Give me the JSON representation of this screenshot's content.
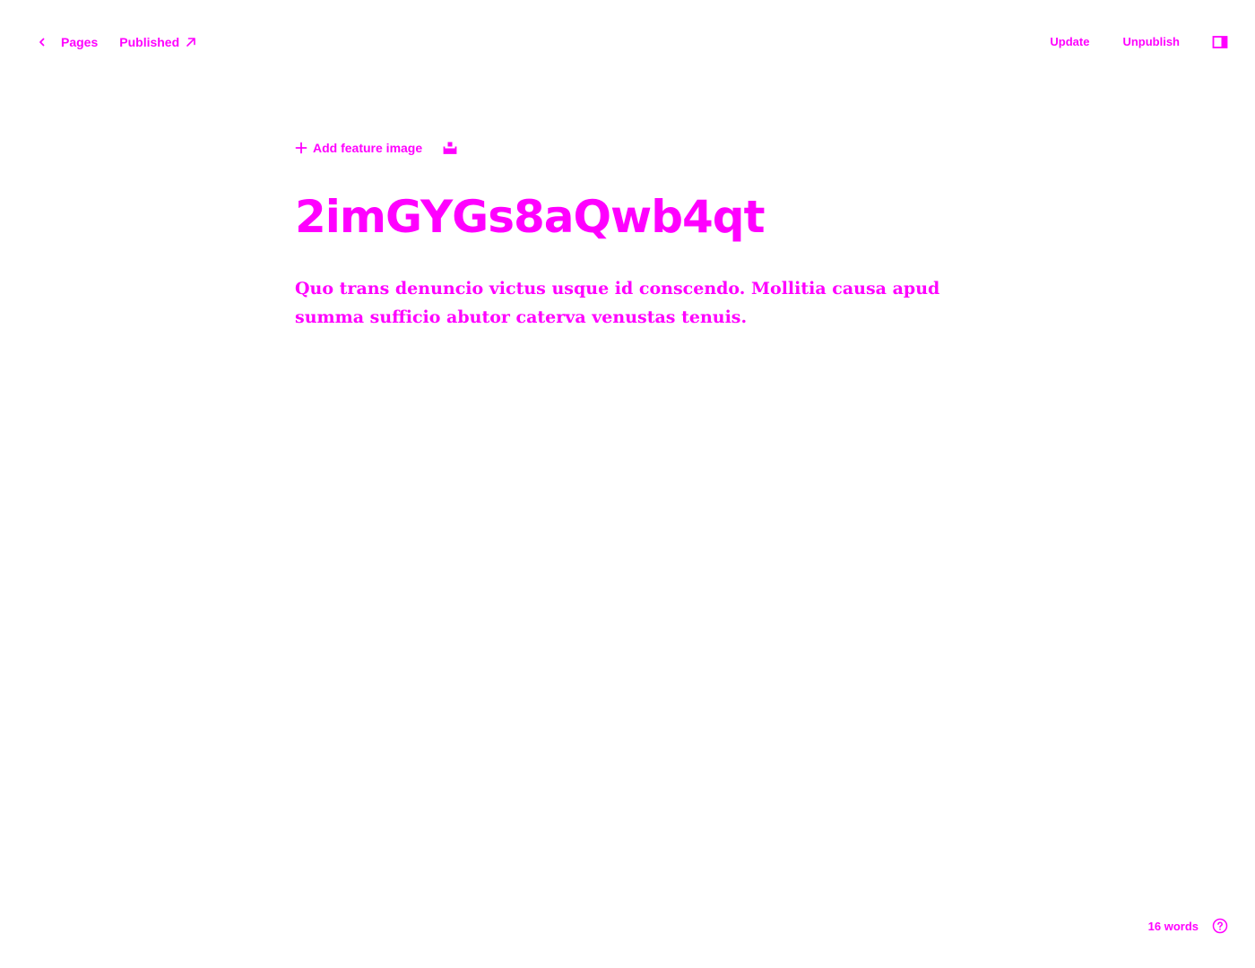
{
  "topbar": {
    "back_label": "Pages",
    "status_label": "Published",
    "update_label": "Update",
    "unpublish_label": "Unpublish",
    "icons": {
      "back": "chevron-left-icon",
      "status": "arrow-up-right-icon",
      "sidebar": "sidebar-toggle-icon"
    }
  },
  "editor": {
    "add_feature_label": "Add feature image",
    "title": "2imGYGs8aQwb4qt",
    "excerpt": "Quo trans denuncio victus usque id conscendo. Mollitia causa apud summa sufficio abutor caterva venustas tenuis.",
    "icons": {
      "add": "plus-icon",
      "snippet": "snippet-icon"
    }
  },
  "footer": {
    "word_count": "16 words",
    "icons": {
      "help": "help-circle-icon"
    }
  },
  "colors": {
    "accent": "#ff00ff",
    "background": "#ffffff"
  }
}
